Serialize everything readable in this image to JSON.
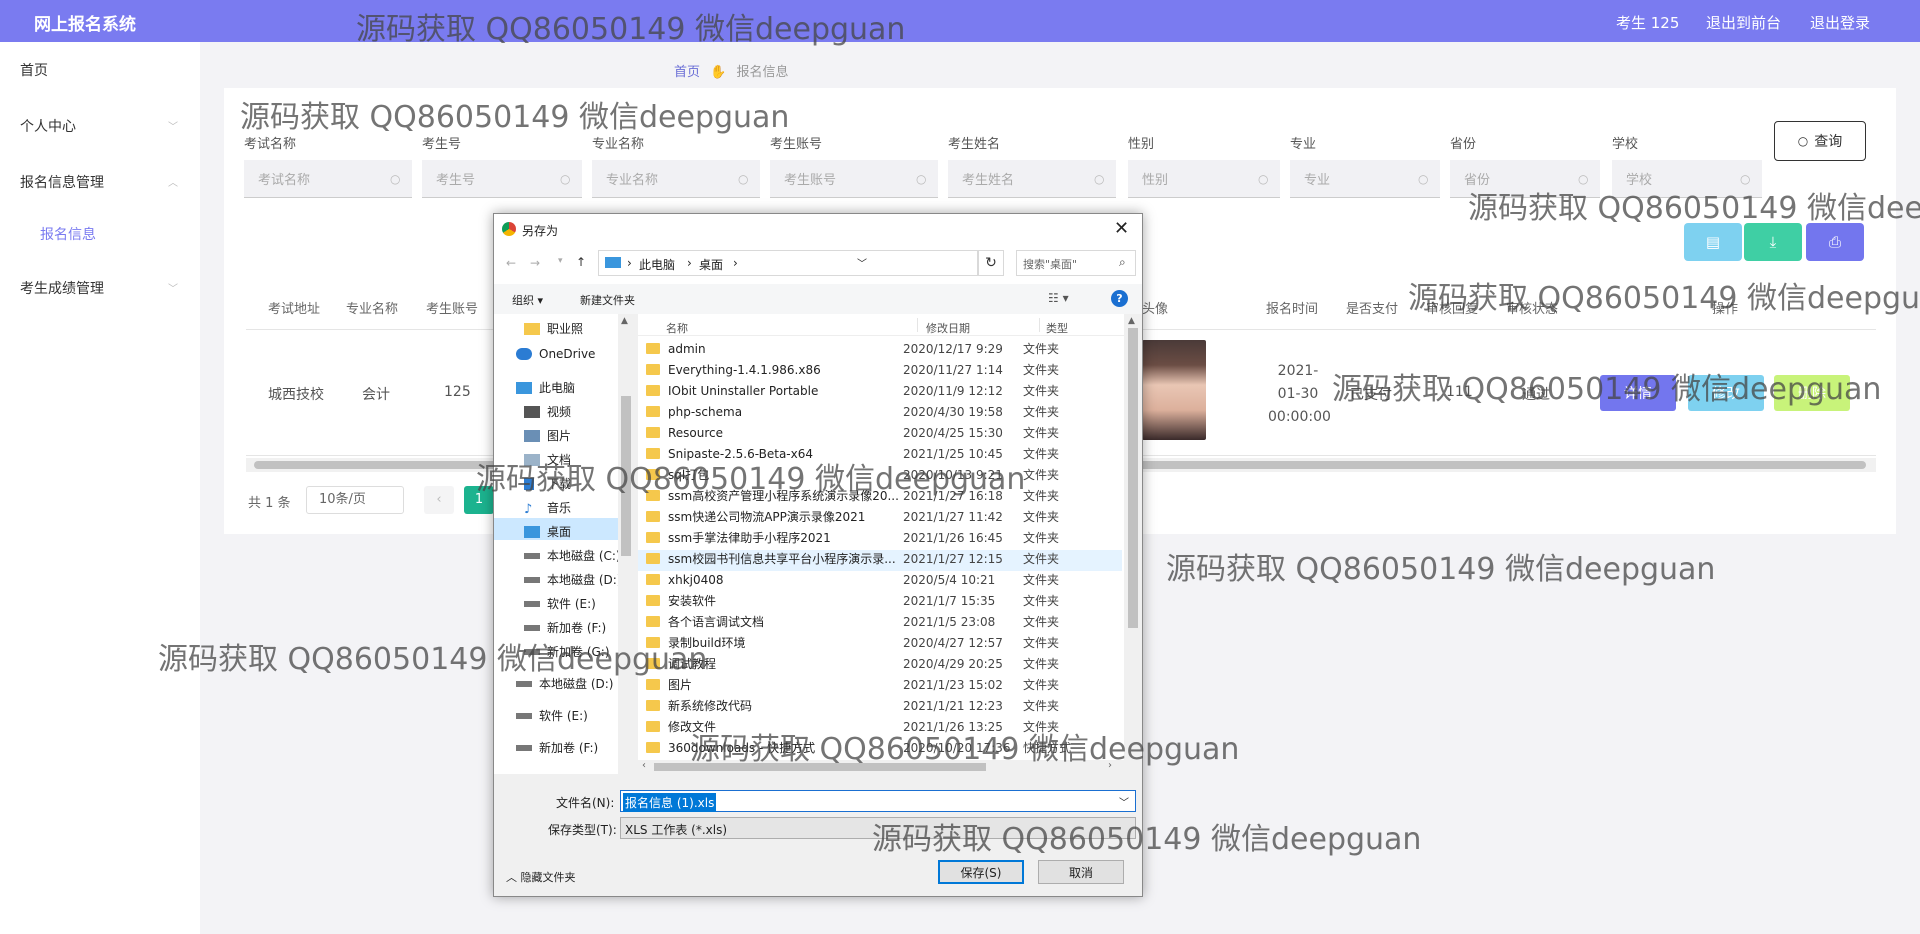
{
  "app": {
    "title": "网上报名系统",
    "user": "考生 125",
    "link_front": "退出到前台",
    "link_logout": "退出登录"
  },
  "sidebar": {
    "items": [
      {
        "label": "首页"
      },
      {
        "label": "个人中心"
      },
      {
        "label": "报名信息管理"
      },
      {
        "label": "报名信息"
      },
      {
        "label": "考生成绩管理"
      }
    ]
  },
  "breadcrumb": {
    "home": "首页",
    "current": "报名信息"
  },
  "search": {
    "fields": [
      {
        "label": "考试名称",
        "placeholder": "考试名称"
      },
      {
        "label": "考生号",
        "placeholder": "考生号"
      },
      {
        "label": "专业名称",
        "placeholder": "专业名称"
      },
      {
        "label": "考生账号",
        "placeholder": "考生账号"
      },
      {
        "label": "考生姓名",
        "placeholder": "考生姓名"
      },
      {
        "label": "性别",
        "placeholder": "性别"
      },
      {
        "label": "专业",
        "placeholder": "专业"
      },
      {
        "label": "省份",
        "placeholder": "省份"
      },
      {
        "label": "学校",
        "placeholder": "学校"
      }
    ],
    "query_label": "查询"
  },
  "colors": {
    "topbar": "#7a7bf0",
    "delete": "#7ed1f0",
    "download": "#3fcfa4",
    "print": "#7376ee",
    "page_active": "#1cb38f"
  },
  "table": {
    "headers": [
      "考试地址",
      "专业名称",
      "考生账号",
      "头像",
      "报名时间",
      "是否支付",
      "审核回复",
      "审核状态",
      "操作"
    ],
    "row": {
      "address": "城西技校",
      "major": "会计",
      "account": "125",
      "time": "2021-01-30 00:00:00",
      "paid": "已支付",
      "reply": "111",
      "status": "通过"
    },
    "actions": {
      "detail": "详情",
      "edit": "修改",
      "delete": "删除"
    }
  },
  "pagination": {
    "total": "共 1 条",
    "page_size": "10条/页",
    "current": "1"
  },
  "dialog": {
    "title": "另存为",
    "path": [
      "此电脑",
      "桌面"
    ],
    "search_placeholder": "搜索\"桌面\"",
    "organize": "组织 ▾",
    "new_folder": "新建文件夹",
    "columns": {
      "name": "名称",
      "date": "修改日期",
      "type": "类型"
    },
    "nav": [
      "职业照",
      "OneDrive",
      "此电脑",
      "视频",
      "图片",
      "文档",
      "下载",
      "音乐",
      "桌面",
      "本地磁盘 (C:)",
      "本地磁盘 (D:)",
      "软件 (E:)",
      "新加卷 (F:)",
      "新加卷 (G:)",
      "本地磁盘 (D:)",
      "软件 (E:)",
      "新加卷 (F:)"
    ],
    "files": [
      {
        "name": "admin",
        "date": "2020/12/17 9:29",
        "type": "文件夹"
      },
      {
        "name": "Everything-1.4.1.986.x86",
        "date": "2020/11/27 1:14",
        "type": "文件夹"
      },
      {
        "name": "IObit Uninstaller Portable",
        "date": "2020/11/9 12:12",
        "type": "文件夹"
      },
      {
        "name": "php-schema",
        "date": "2020/4/30 19:58",
        "type": "文件夹"
      },
      {
        "name": "Resource",
        "date": "2020/4/25 15:30",
        "type": "文件夹"
      },
      {
        "name": "Snipaste-2.5.6-Beta-x64",
        "date": "2021/1/25 10:45",
        "type": "文件夹"
      },
      {
        "name": "sql打包",
        "date": "2020/10/13 9:21",
        "type": "文件夹"
      },
      {
        "name": "ssm高校资产管理小程序系统演示录像20...",
        "date": "2021/1/27 16:18",
        "type": "文件夹"
      },
      {
        "name": "ssm快递公司物流APP演示录像2021",
        "date": "2021/1/27 11:42",
        "type": "文件夹"
      },
      {
        "name": "ssm手掌法律助手小程序2021",
        "date": "2021/1/26 16:45",
        "type": "文件夹"
      },
      {
        "name": "ssm校园书刊信息共享平台小程序演示录...",
        "date": "2021/1/27 12:15",
        "type": "文件夹"
      },
      {
        "name": "xhkj0408",
        "date": "2020/5/4 10:21",
        "type": "文件夹"
      },
      {
        "name": "安装软件",
        "date": "2021/1/7 15:35",
        "type": "文件夹"
      },
      {
        "name": "各个语言调试文档",
        "date": "2021/1/5 23:08",
        "type": "文件夹"
      },
      {
        "name": "录制build环境",
        "date": "2020/4/27 12:57",
        "type": "文件夹"
      },
      {
        "name": "调试教程",
        "date": "2020/4/29 20:25",
        "type": "文件夹"
      },
      {
        "name": "图片",
        "date": "2021/1/23 15:02",
        "type": "文件夹"
      },
      {
        "name": "新系统修改代码",
        "date": "2021/1/21 12:23",
        "type": "文件夹"
      },
      {
        "name": "修改文件",
        "date": "2021/1/26 13:25",
        "type": "文件夹"
      },
      {
        "name": "360downloads - 快捷方式",
        "date": "2020/10/20 17:36",
        "type": "快捷方式"
      }
    ],
    "filename_label": "文件名(N):",
    "filename_value": "报名信息 (1).xls",
    "filetype_label": "保存类型(T):",
    "filetype_value": "XLS 工作表 (*.xls)",
    "hide_folders": "隐藏文件夹",
    "save": "保存(S)",
    "cancel": "取消"
  },
  "watermark": "源码获取 QQ86050149 微信deepguan"
}
